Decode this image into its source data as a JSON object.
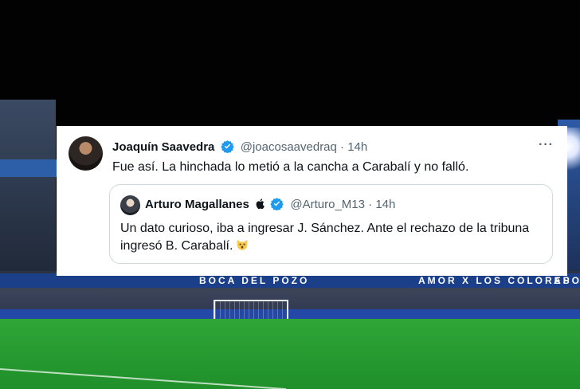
{
  "background": {
    "banner_left": "BOCA DEL POZO",
    "banner_right": "AMOR X LOS COLORES",
    "banner_far_right": "APOO"
  },
  "tweet": {
    "author_name": "Joaquín Saavedra",
    "author_handle": "@joacosaavedraq",
    "separator": "·",
    "time": "14h",
    "more": "···",
    "text": "Fue así. La hinchada lo metió a la cancha a Carabalí y no falló.",
    "verified_color": "#1d9bf0"
  },
  "quoted_tweet": {
    "author_name": "Arturo Magallanes",
    "author_handle": "@Arturo_M13",
    "separator": "·",
    "time": "14h",
    "text": "Un dato curioso, iba a ingresar J. Sánchez. Ante el rechazo de la tribuna ingresó B. Carabalí."
  }
}
